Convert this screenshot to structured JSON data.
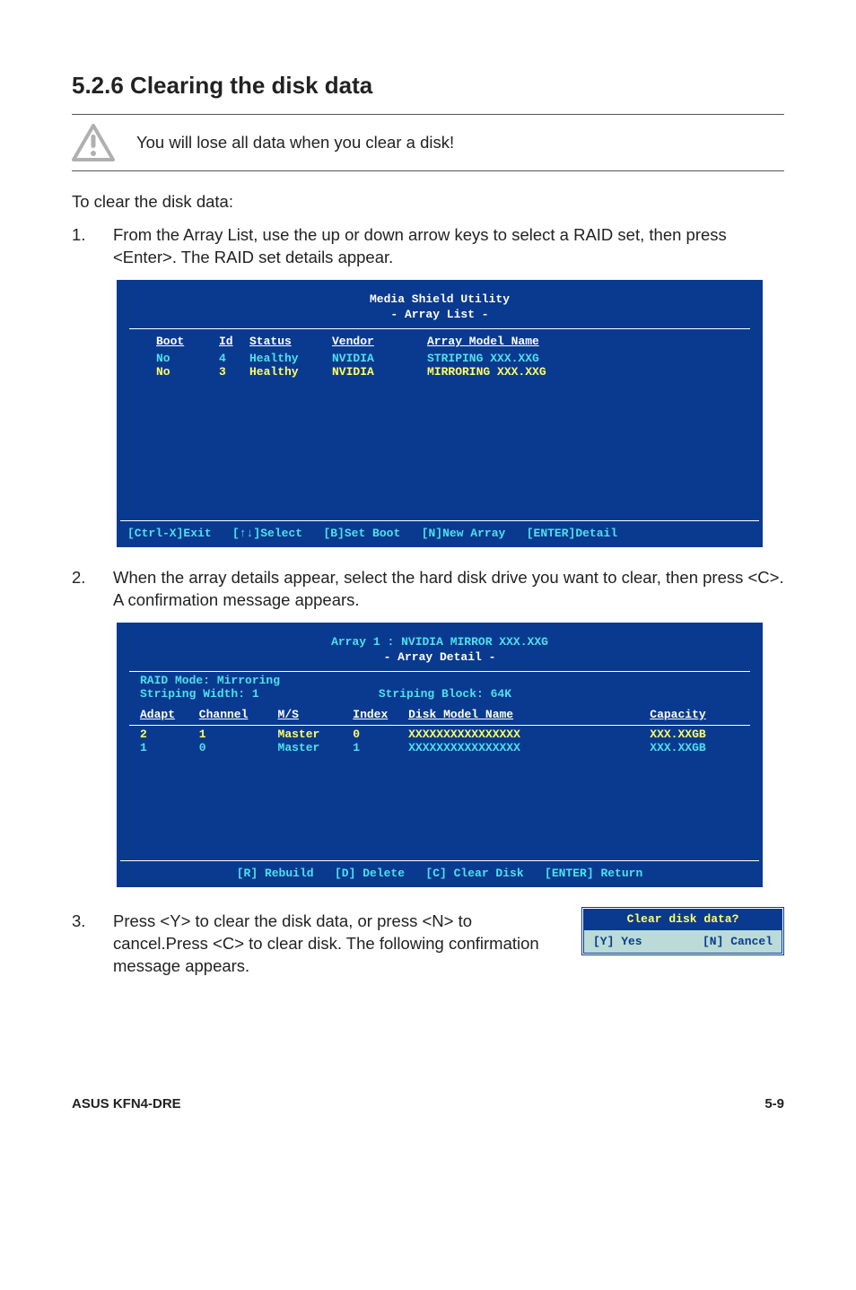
{
  "heading": "5.2.6   Clearing the disk data",
  "warning_note": "You will lose all data when you clear a disk!",
  "intro": "To clear the disk data:",
  "step1_num": "1.",
  "step1_text": "From the Array List, use the up or down arrow keys to select a RAID set, then press <Enter>. The RAID set details appear.",
  "console1": {
    "title": "Media Shield Utility",
    "subtitle": "- Array List -",
    "headers": {
      "boot": "Boot",
      "id": "Id",
      "status": "Status",
      "vendor": "Vendor",
      "name": "Array Model Name"
    },
    "rows": [
      {
        "boot": "No",
        "id": "4",
        "status": "Healthy",
        "vendor": "NVIDIA",
        "name": "STRIPING  XXX.XXG"
      },
      {
        "boot": "No",
        "id": "3",
        "status": "Healthy",
        "vendor": "NVIDIA",
        "name": "MIRRORING XXX.XXG"
      }
    ],
    "footer": {
      "exit": "[Ctrl-X]Exit",
      "select": "[↑↓]Select",
      "setboot": "[B]Set Boot",
      "newarr": "[N]New Array",
      "detail": "[ENTER]Detail"
    }
  },
  "step2_num": "2.",
  "step2_text": "When the array details appear, select the hard disk drive you want to clear, then press <C>. A confirmation message appears.",
  "console2": {
    "title": "Array 1 : NVIDIA MIRROR  XXX.XXG",
    "subtitle": "- Array Detail -",
    "raid_mode": "RAID Mode: Mirroring",
    "strip_width": "Striping Width: 1",
    "strip_block": "Striping Block: 64K",
    "headers": {
      "adapt": "Adapt",
      "channel": "Channel",
      "ms": "M/S",
      "index": "Index",
      "model": "Disk Model Name",
      "cap": "Capacity"
    },
    "rows": [
      {
        "adapt": "2",
        "channel": "1",
        "ms": "Master",
        "index": "0",
        "model": "XXXXXXXXXXXXXXXX",
        "cap": "XXX.XXGB"
      },
      {
        "adapt": "1",
        "channel": "0",
        "ms": "Master",
        "index": "1",
        "model": "XXXXXXXXXXXXXXXX",
        "cap": "XXX.XXGB"
      }
    ],
    "footer": {
      "rebuild": "[R] Rebuild",
      "delete": "[D] Delete",
      "clear": "[C] Clear Disk",
      "return": "[ENTER] Return"
    }
  },
  "step3_num": "3.",
  "step3_text": "Press <Y> to clear the disk data, or press <N> to cancel.Press <C> to clear disk. The following confirmation message appears.",
  "dialog": {
    "title": "Clear disk data?",
    "yes": "[Y] Yes",
    "no": "[N] Cancel"
  },
  "footer": {
    "left": "ASUS KFN4-DRE",
    "right": "5-9"
  },
  "chart_data": {
    "type": "table",
    "title": "Media Shield Utility — Array List",
    "columns": [
      "Boot",
      "Id",
      "Status",
      "Vendor",
      "Array Model Name"
    ],
    "rows": [
      [
        "No",
        4,
        "Healthy",
        "NVIDIA",
        "STRIPING XXX.XXG"
      ],
      [
        "No",
        3,
        "Healthy",
        "NVIDIA",
        "MIRRORING XXX.XXG"
      ]
    ]
  }
}
